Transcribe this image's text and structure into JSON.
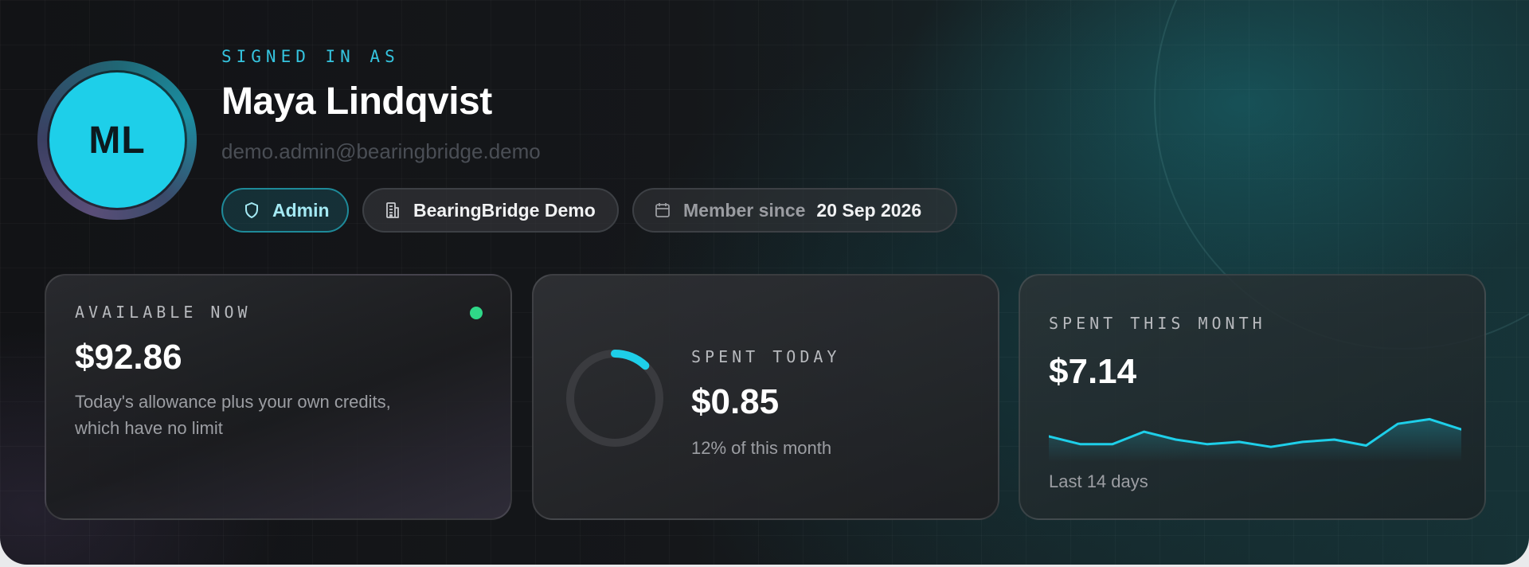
{
  "profile": {
    "signed_in_label": "SIGNED IN AS",
    "initials": "ML",
    "name": "Maya Lindqvist",
    "email": "demo.admin@bearingbridge.demo",
    "avatar_color": "#1ecfe9"
  },
  "chips": {
    "role": {
      "icon": "shield-icon",
      "label": "Admin"
    },
    "organization": {
      "icon": "building-icon",
      "label": "BearingBridge Demo"
    },
    "member_since": {
      "icon": "calendar-icon",
      "label": "Member since",
      "date": "20 Sep 2026"
    }
  },
  "cards": {
    "available": {
      "label": "AVAILABLE NOW",
      "value": "$92.86",
      "note_line1": "Today's allowance plus your own credits,",
      "note_line2": "which have no limit",
      "status_color": "#2fd888"
    },
    "spent_today": {
      "label": "SPENT TODAY",
      "value": "$0.85",
      "note": "12% of this month",
      "ring_fraction": 0.12,
      "ring_color": "#1ecfe9"
    },
    "spent_month": {
      "label": "SPENT THIS MONTH",
      "value": "$7.14",
      "note": "Last 14 days",
      "sparkline_values": [
        0.45,
        0.28,
        0.28,
        0.55,
        0.38,
        0.28,
        0.33,
        0.22,
        0.33,
        0.38,
        0.25,
        0.72,
        0.82,
        0.6
      ],
      "line_color": "#1ecfe9"
    }
  },
  "colors": {
    "accent": "#1ecfe9",
    "status_green": "#2fd888"
  }
}
